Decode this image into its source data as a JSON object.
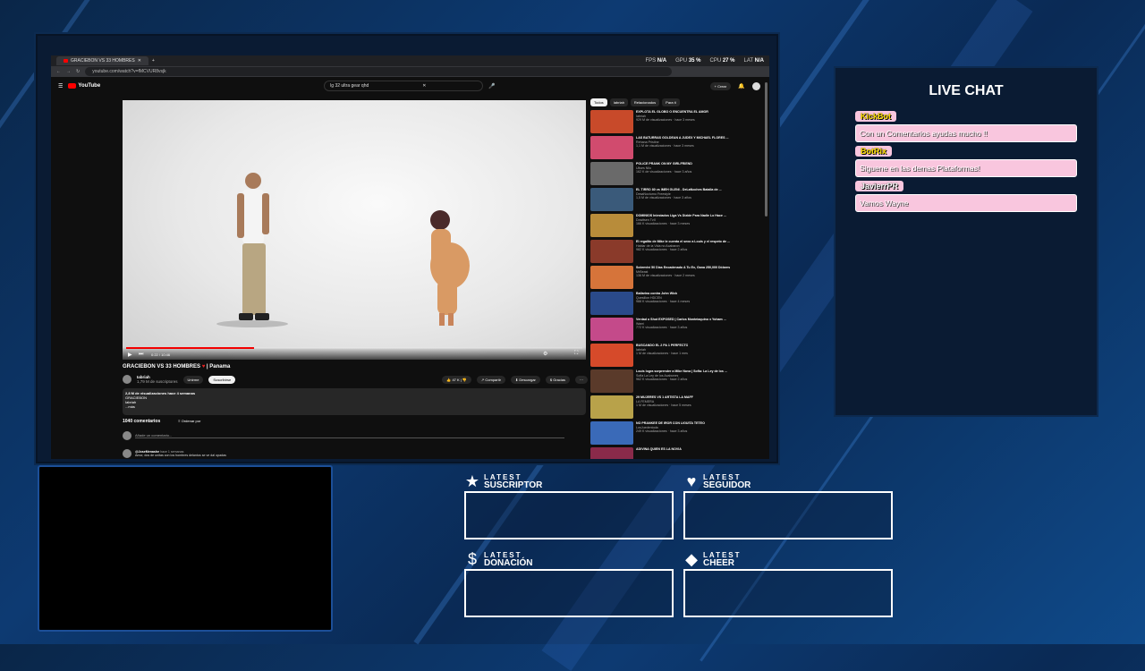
{
  "browser": {
    "tab_title": "GRACIEBON VS 33 HOMBRES",
    "url": "youtube.com/watch?v=fMCVUR8vsjk",
    "stats": {
      "fps_label": "FPS",
      "fps": "N/A",
      "gpu_label": "GPU",
      "gpu": "35 %",
      "cpu_label": "CPU",
      "cpu": "27 %",
      "lat_label": "LAT",
      "lat": "N/A"
    }
  },
  "youtube": {
    "logo": "YouTube",
    "search_value": "lg 32 ultra gear qhd",
    "create_label": "Crear",
    "video": {
      "time": "0:22 / 10:46",
      "title": "GRACIEBON VS 33 HOMBRES",
      "title_suffix": "| Panama",
      "channel": "Iabriah",
      "subs": "1,79 M de suscriptores",
      "members_label": "Unirme",
      "subscribe_label": "Suscribirse",
      "likes": "47 K",
      "share_label": "Compartir",
      "download_label": "Descargar",
      "thanks_label": "Gracias",
      "views": "2,8 M de visualizaciones  hace 4 semanas",
      "desc_line1": "GRACIEBON",
      "desc_line2": "Iabriah",
      "more_label": "...más"
    },
    "comments": {
      "count": "1040 comentarios",
      "sort": "Ordenar por",
      "placeholder": "Añade un comentario...",
      "first_user": "@JoseMenashe",
      "first_time": "hace 1 semanas",
      "first_text": "Amor, dos de unitas con los hombres delantos se ve dal opadas"
    },
    "chips": [
      "Todos",
      "Iabriah",
      "Relacionados",
      "Para ti"
    ],
    "related": [
      {
        "title": "EXPLOTA EL GLOBO O ENCUENTRA EL AMOR",
        "channel": "Iabriah",
        "meta": "929 M de visualizaciones · hace 3 meses",
        "color": "#c84a2a"
      },
      {
        "title": "LAS BATURRAS GOLDEAN A JUDEX Y MICHAEL FLORES ...",
        "channel": "Rehana Pristine",
        "meta": "1,1 M de visualizaciones · hace 3 meses",
        "color": "#d14b6e"
      },
      {
        "title": "POLICE PRANK ON MY GIRLFRIEND",
        "channel": "Ulises Nilo",
        "meta": "162 K de visualizaciones · hace 3 años",
        "color": "#6a6a6a"
      },
      {
        "title": "EL TIRRO 80 vs IMEH GLENI - DeLaNoches Batalla de ...",
        "channel": "DesaNocturno Freestyle",
        "meta": "1,5 M de visualizaciones · hace 3 años",
        "color": "#3a5a7a"
      },
      {
        "title": "DOMINIOS Iniestados Liga Vs Dizide Para Nadie Lo Hace ...",
        "channel": "Dowitsen TvX",
        "meta": "166 K visualizaciones · hace 3 meses",
        "color": "#b88c3a"
      },
      {
        "title": "El regalito de Mike le cuenta el sexo a Louis y el respeto de ...",
        "channel": "Hablar de la Vida no Acabaron",
        "meta": "982 K visualizaciones · hace 2 años",
        "color": "#8a3a2a"
      },
      {
        "title": "Sobreviví 50 Días Encadenado A Tu Ex, Gana 250,000 Dólares",
        "channel": "MrBeast",
        "meta": "136 M de visualizaciones · hace 2 meses",
        "color": "#d6743a"
      },
      {
        "title": "Bailarina contra John Wick",
        "channel": "Quesillon HDCEN",
        "meta": "988 K visualizaciones · hace 4 meses",
        "color": "#2a4a8a"
      },
      {
        "title": "Verdad o Shot EXPOSED | Carlos Monteiaquino x Yoham ...",
        "channel": "Wami",
        "meta": "772 K visualizaciones · hace 3 años",
        "color": "#c44a8a"
      },
      {
        "title": "BUSCANDO EL 2 PA 1 PERFECTO",
        "channel": "Iabriah",
        "meta": "1 M de visualizaciones · hace 1 mes",
        "color": "#d64a2a"
      },
      {
        "title": "Louis logra sorprender a Mike Nova | Sofia: La Ley de los ...",
        "channel": "Sofia La Ley de los Acabones",
        "meta": "962 K visualizaciones · hace 2 años",
        "color": "#5a3a2a"
      },
      {
        "title": "29 MUJERES VS 1 ARTISTA LA MAFF",
        "channel": "LA FEMERA",
        "meta": "1 M de visualizaciones · hace 5 meses",
        "color": "#b8a24a"
      },
      {
        "title": "NO PRANKEE DE IROR CON LIGUITA TETEO",
        "channel": "LosJuedentoda",
        "meta": "249 K visualizaciones · hace 3 años",
        "color": "#3a6ab8"
      },
      {
        "title": "ADIVINA QUIEN ES LA NOVIA",
        "channel": "",
        "meta": "",
        "color": "#8a2a4a"
      }
    ]
  },
  "chat": {
    "title": "LIVE CHAT",
    "messages": [
      {
        "user": "KickBot",
        "text": "Con un Comentarios ayudas mucho !!"
      },
      {
        "user": "BotRix",
        "text": "Siguene en las demas Plataformas!"
      },
      {
        "user": "JavierrPR",
        "text": "Vamos Wayne"
      }
    ]
  },
  "latest": [
    {
      "small": "LATEST",
      "big": "SUSCRIPTOR",
      "icon": "★",
      "icon_name": "star-icon"
    },
    {
      "small": "LATEST",
      "big": "SEGUIDOR",
      "icon": "♥",
      "icon_name": "heart-icon"
    },
    {
      "small": "LATEST",
      "big": "DONACIÓN",
      "icon": "$",
      "icon_name": "dollar-icon"
    },
    {
      "small": "LATEST",
      "big": "CHEER",
      "icon": "◆",
      "icon_name": "diamond-icon"
    }
  ]
}
